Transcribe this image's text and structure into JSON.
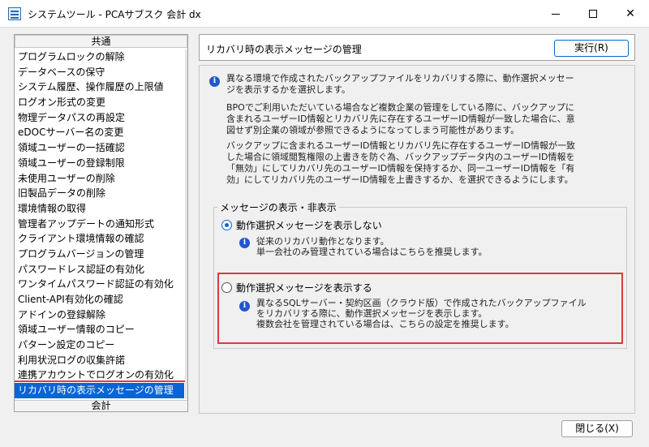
{
  "window": {
    "title": "システムツール - PCAサブスク 会計 dx",
    "minimize_icon": "minimize-icon",
    "maximize_icon": "maximize-icon",
    "close_icon": "close-icon"
  },
  "sidebar": {
    "header": "共通",
    "footer": "会計",
    "selected_index": 22,
    "items": [
      "プログラムロックの解除",
      "データベースの保守",
      "システム履歴、操作履歴の上限値",
      "ログオン形式の変更",
      "物理データパスの再設定",
      "eDOCサーバー名の変更",
      "領域ユーザーの一括確認",
      "領域ユーザーの登録制限",
      "未使用ユーザーの削除",
      "旧製品データの削除",
      "環境情報の取得",
      "管理者アップデートの通知形式",
      "クライアント環境情報の確認",
      "プログラムバージョンの管理",
      "パスワードレス認証の有効化",
      "ワンタイムパスワード認証の有効化",
      "Client-API有効化の確認",
      "アドインの登録解除",
      "領域ユーザー情報のコピー",
      "パターン設定のコピー",
      "利用状況ログの収集許諾",
      "連携アカウントでログオンの有効化",
      "リカバリ時の表示メッセージの管理"
    ]
  },
  "main": {
    "title": "リカバリ時の表示メッセージの管理",
    "execute_label": "実行(R)",
    "description_lines": [
      "異なる環境で作成されたバックアップファイルをリカバリする際に、動作選択メッセー",
      "ジを表示するかを選択します。"
    ],
    "paragraph2_lines": [
      "BPOでご利用いただいている場合など複数企業の管理をしている際に、バックアップに",
      "含まれるユーザーID情報とリカバリ先に存在するユーザーID情報が一致した場合に、意",
      "図せず別企業の領域が参照できるようになってしまう可能性があります。"
    ],
    "paragraph3_lines": [
      "バックアップに含まれるユーザーID情報とリカバリ先に存在するユーザーID情報が一致",
      "した場合に領域閲覧権限の上書きを防ぐ為、バックアップデータ内のユーザーID情報を",
      "「無効」にしてリカバリ先のユーザーID情報を保持するか、同一ユーザーID情報を「有",
      "効」にしてリカバリ先のユーザーID情報を上書きするか、を選択できるようにします。"
    ],
    "group_title": "メッセージの表示・非表示",
    "option1": {
      "label": "動作選択メッセージを表示しない",
      "checked": true,
      "desc_lines": [
        "従来のリカバリ動作となります。",
        "単一会社のみ管理されている場合はこちらを推奨します。"
      ]
    },
    "option2": {
      "label": "動作選択メッセージを表示する",
      "checked": false,
      "desc_lines": [
        "異なるSQLサーバー・契約区画（クラウド版）で作成されたバックアップファイル",
        "をリカバリする際に、動作選択メッセージを表示します。",
        "複数会社を管理されている場合は、こちらの設定を推奨します。"
      ]
    },
    "info_icon": "info-icon"
  },
  "footer": {
    "close_label": "閉じる(X)"
  },
  "colors": {
    "selection": "#0a64d6",
    "highlight": "#e03a3a",
    "info": "#2157c9"
  }
}
